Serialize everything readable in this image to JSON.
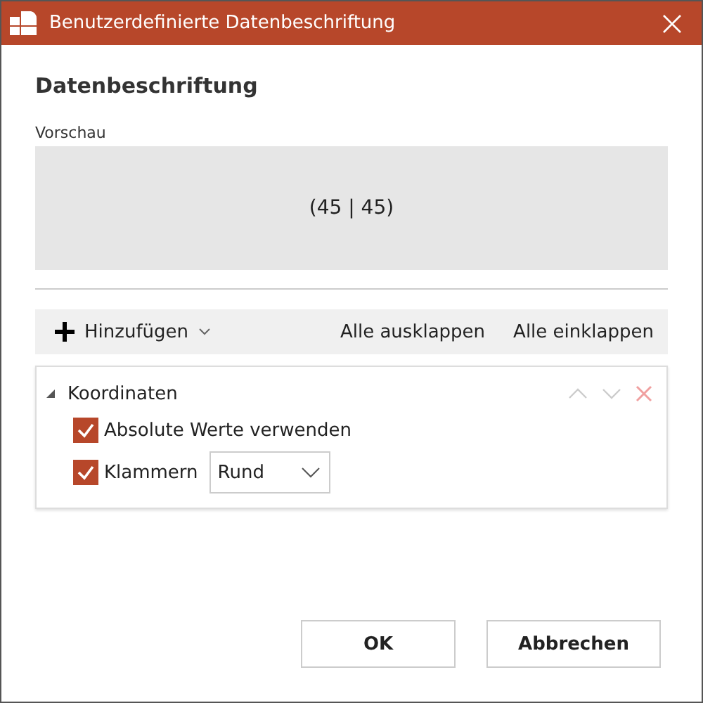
{
  "window": {
    "title": "Benutzerdefinierte Datenbeschriftung"
  },
  "heading": "Datenbeschriftung",
  "preview": {
    "label": "Vorschau",
    "text": "(45 | 45)"
  },
  "toolbar": {
    "add_button": "Hinzufügen",
    "actions": [
      "Alle ausklappen",
      "Alle einklappen"
    ]
  },
  "groups": [
    {
      "title": "Koordinaten",
      "expanded": true,
      "options": [
        {
          "kind": "checkbox",
          "label": "Absolute Werte verwenden",
          "checked": true
        },
        {
          "kind": "checkbox-select",
          "label": "Klammern",
          "checked": true,
          "value": "Rund"
        }
      ]
    }
  ],
  "buttons": [
    "OK",
    "Abbrechen"
  ]
}
